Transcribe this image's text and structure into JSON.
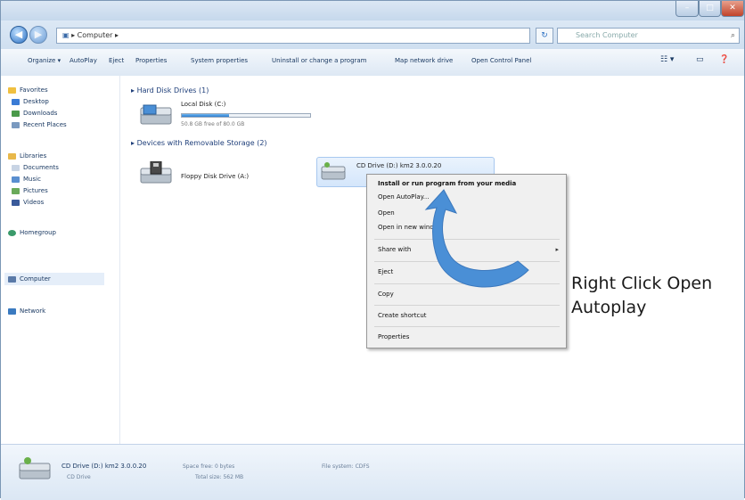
{
  "window": {
    "address_path": "▸ Computer ▸",
    "search_placeholder": "Search Computer"
  },
  "toolbar": {
    "organize": "Organize ▾",
    "autoplay": "AutoPlay",
    "eject": "Eject",
    "properties": "Properties",
    "system_properties": "System properties",
    "uninstall": "Uninstall or change a program",
    "map_network_drive": "Map network drive",
    "open_control_panel": "Open Control Panel"
  },
  "sidebar": {
    "items": [
      {
        "label": "Favorites",
        "icon": "star-icon"
      },
      {
        "label": "Desktop",
        "icon": "desktop-icon"
      },
      {
        "label": "Downloads",
        "icon": "downloads-icon"
      },
      {
        "label": "Recent Places",
        "icon": "recent-places-icon"
      },
      {
        "label": "Libraries",
        "icon": "libraries-icon"
      },
      {
        "label": "Documents",
        "icon": "documents-icon"
      },
      {
        "label": "Music",
        "icon": "music-icon"
      },
      {
        "label": "Pictures",
        "icon": "pictures-icon"
      },
      {
        "label": "Videos",
        "icon": "videos-icon"
      },
      {
        "label": "Homegroup",
        "icon": "homegroup-icon"
      },
      {
        "label": "Computer",
        "icon": "computer-icon"
      },
      {
        "label": "Network",
        "icon": "network-icon"
      }
    ]
  },
  "content": {
    "hard_disk_group": "Hard Disk Drives (1)",
    "local_disk_label": "Local Disk (C:)",
    "local_disk_free": "50.8 GB free of 80.0 GB",
    "local_disk_used_fraction": 0.37,
    "removable_group": "Devices with Removable Storage (2)",
    "floppy_label": "Floppy Disk Drive (A:)",
    "cd_label": "CD Drive (D:) km2 3.0.0.20"
  },
  "context_menu": {
    "install": "Install or run program from your media",
    "open_autoplay": "Open AutoPlay...",
    "open": "Open",
    "open_new_window": "Open in new window",
    "share_with": "Share with",
    "eject": "Eject",
    "copy": "Copy",
    "create_shortcut": "Create shortcut",
    "properties": "Properties"
  },
  "status": {
    "drive_name": "CD Drive (D:) km2 3.0.0.20",
    "drive_type": "CD Drive",
    "space_free": "Space free: 0 bytes",
    "total_size": "Total size: 562 MB",
    "file_system": "File system: CDFS"
  },
  "annotation": {
    "line1": "Right Click Open",
    "line2": "Autoplay"
  },
  "colors": {
    "arrow": "#4a8fd6",
    "accent": "#2a6fc2"
  }
}
